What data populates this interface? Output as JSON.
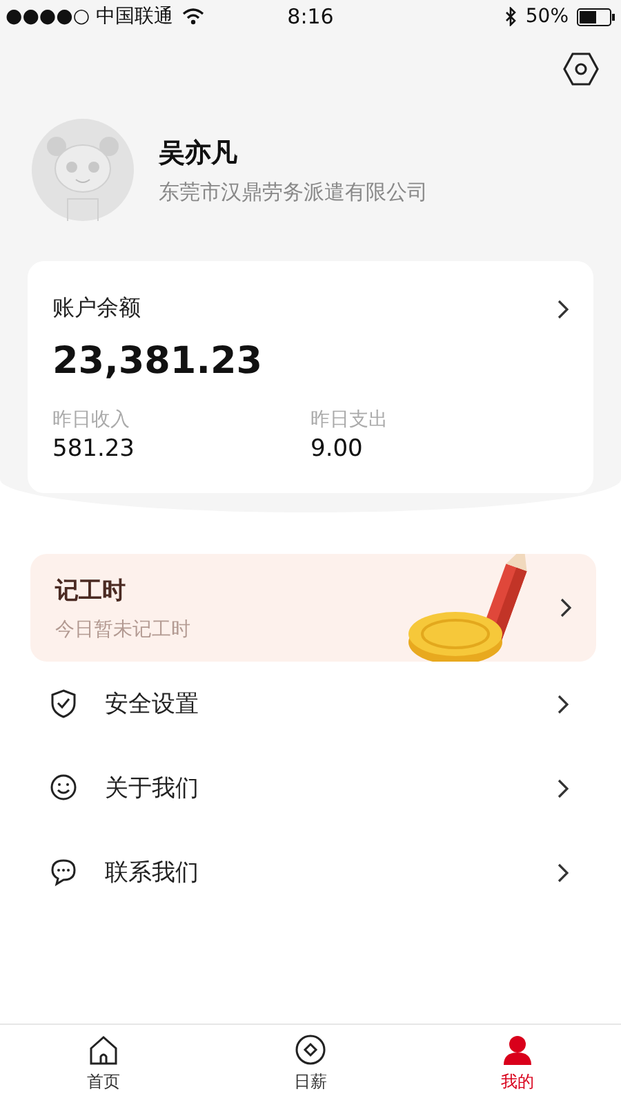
{
  "status_bar": {
    "carrier": "●●●●○ 中国联通",
    "time": "8:16",
    "battery": "50%"
  },
  "profile": {
    "name": "吴亦凡",
    "company": "东莞市汉鼎劳务派遣有限公司"
  },
  "account": {
    "title": "账户余额",
    "balance": "23,381.23",
    "stats": [
      {
        "label": "昨日收入",
        "value": "581.23"
      },
      {
        "label": "昨日支出",
        "value": "9.00"
      }
    ]
  },
  "work_hours": {
    "title": "记工时",
    "subtitle": "今日暂未记工时"
  },
  "menu": [
    {
      "label": "安全设置"
    },
    {
      "label": "关于我们"
    },
    {
      "label": "联系我们"
    }
  ],
  "tabs": [
    {
      "label": "首页",
      "selected": false
    },
    {
      "label": "日薪",
      "selected": false
    },
    {
      "label": "我的",
      "selected": true
    }
  ]
}
